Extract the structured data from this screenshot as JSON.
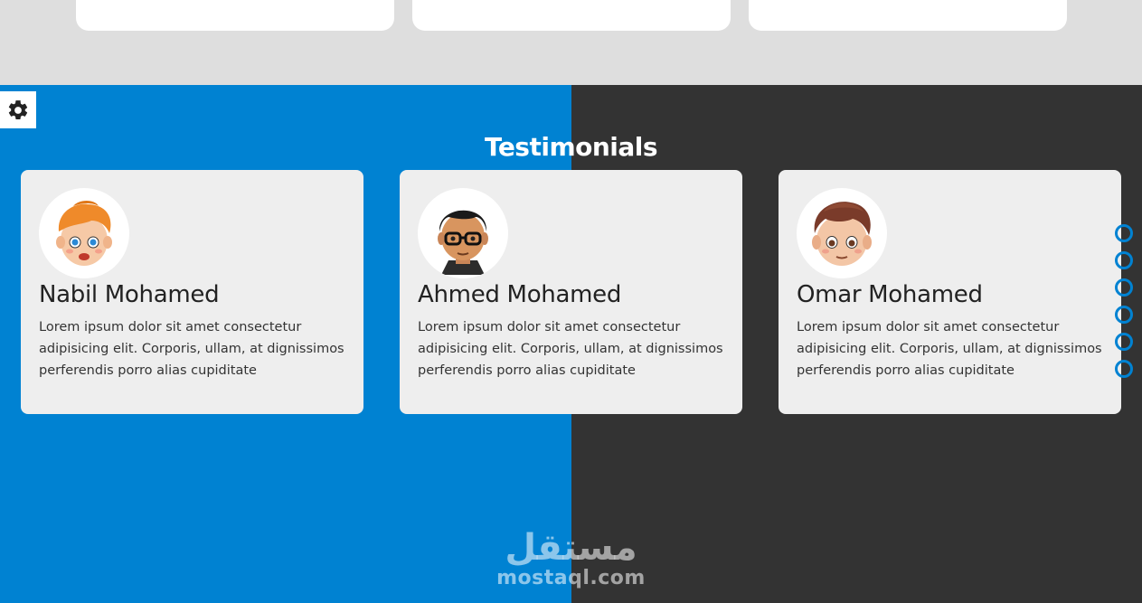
{
  "section": {
    "title": "Testimonials"
  },
  "testimonials": [
    {
      "name": "Nabil Mohamed",
      "text": "Lorem ipsum dolor sit amet consectetur adipisicing elit. Corporis, ullam, at dignissimos perferendis porro alias cupiditate",
      "avatar_icon": "avatar-orange-hair-icon"
    },
    {
      "name": "Ahmed Mohamed",
      "text": "Lorem ipsum dolor sit amet consectetur adipisicing elit. Corporis, ullam, at dignissimos perferendis porro alias cupiditate",
      "avatar_icon": "avatar-glasses-icon"
    },
    {
      "name": "Omar Mohamed",
      "text": "Lorem ipsum dolor sit amet consectetur adipisicing elit. Corporis, ullam, at dignissimos perferendis porro alias cupiditate",
      "avatar_icon": "avatar-brown-hair-icon"
    }
  ],
  "nav_bullets_count": 6,
  "watermark": {
    "arabic": "مستقل",
    "latin": "mostaql.com"
  },
  "colors": {
    "accent": "#0082d2",
    "dark": "#333333",
    "card": "#eeeeee",
    "page": "#dedede"
  }
}
